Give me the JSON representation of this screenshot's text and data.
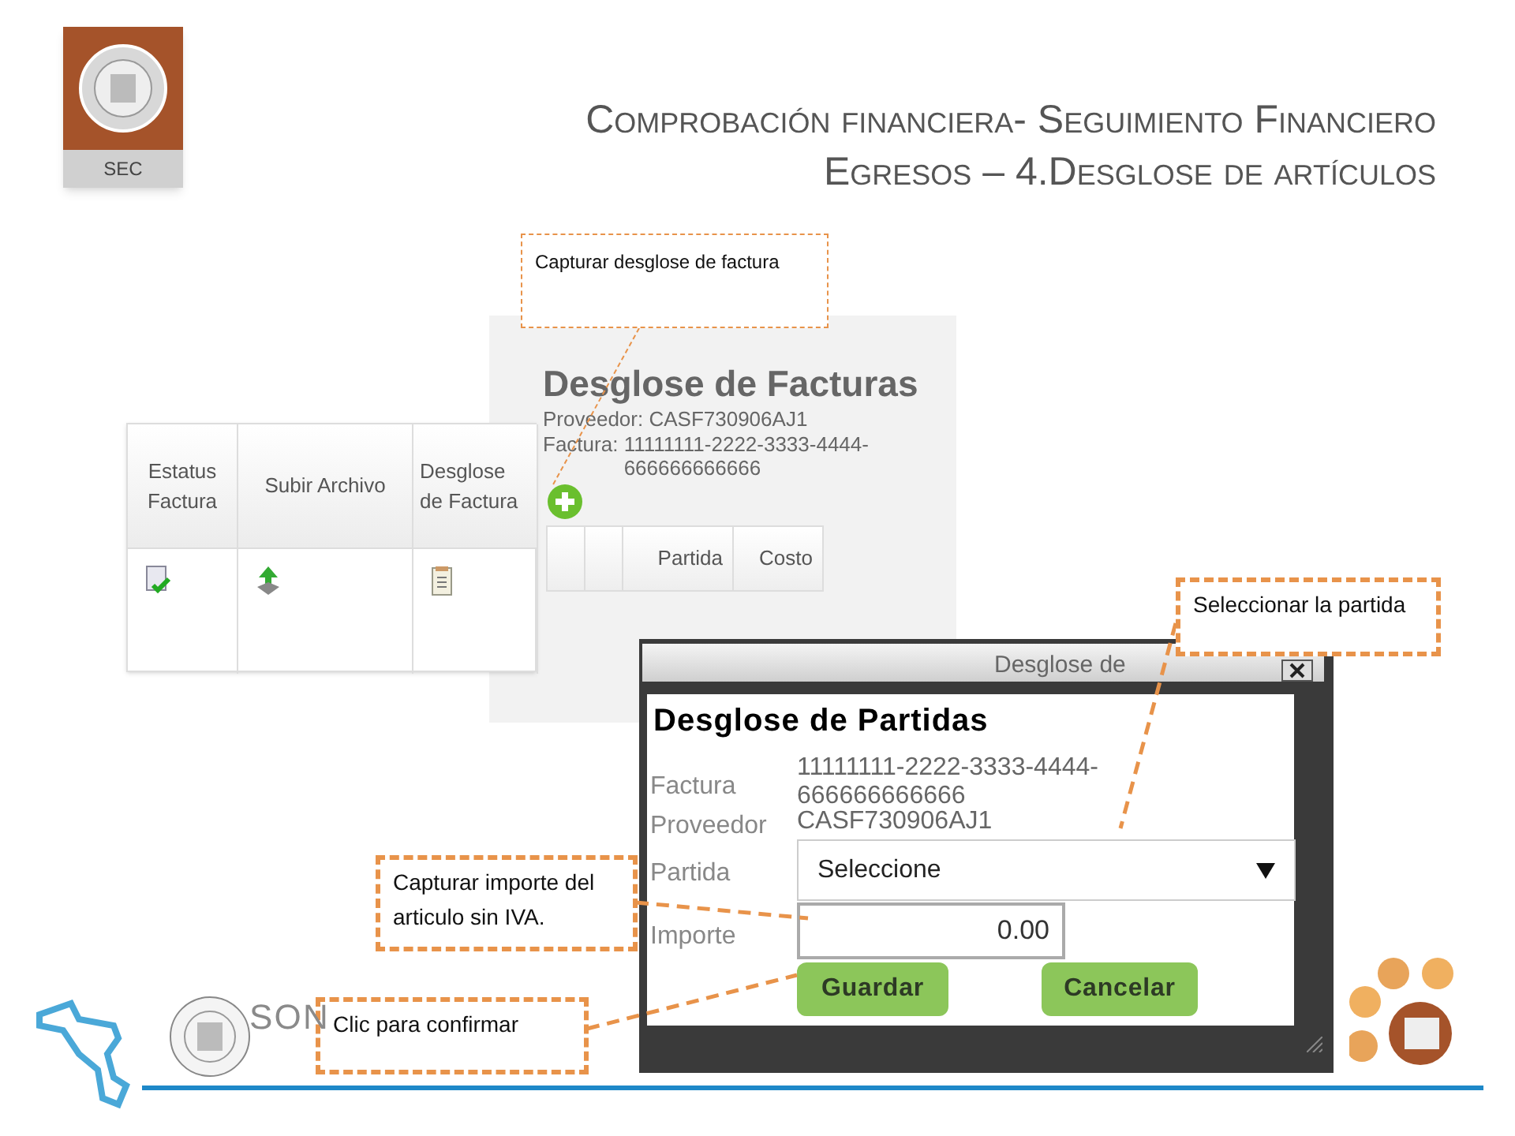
{
  "logo": {
    "label": "SEC"
  },
  "title_lines": [
    "Comprobación financiera- Seguimiento Financiero",
    "Egresos – 4.Desglose de artículos"
  ],
  "invoice_table": {
    "columns": [
      "Estatus Factura",
      "Subir Archivo",
      "Desglose de Factura"
    ]
  },
  "facturas_panel": {
    "title": "Desglose de Facturas",
    "fields": [
      {
        "label": "Proveedor:",
        "value": "CASF730906AJ1"
      },
      {
        "label": "Factura:",
        "value": "11111111-2222-3333-4444-666666666666"
      }
    ],
    "columns": [
      "Partida",
      "Costo"
    ]
  },
  "dialog": {
    "title": "Desglose de",
    "heading": "Desglose de Partidas",
    "fields": [
      {
        "kind": "text",
        "label": "Factura",
        "value": "11111111-2222-3333-4444-666666666666"
      },
      {
        "kind": "text",
        "label": "Proveedor",
        "value": "CASF730906AJ1"
      },
      {
        "kind": "select",
        "label": "Partida",
        "value": "Seleccione"
      },
      {
        "kind": "input",
        "label": "Importe",
        "value": "0.00"
      }
    ],
    "buttons": [
      "Guardar",
      "Cancelar"
    ]
  },
  "callouts": [
    {
      "kind": "note",
      "text": "Capturar desglose de factura"
    },
    {
      "kind": "step",
      "text": "Seleccionar la partida"
    },
    {
      "kind": "step",
      "text": "Capturar importe del articulo sin IVA."
    },
    {
      "kind": "step",
      "text": "Clic para confirmar"
    }
  ],
  "footer": {
    "brand": "SON"
  }
}
